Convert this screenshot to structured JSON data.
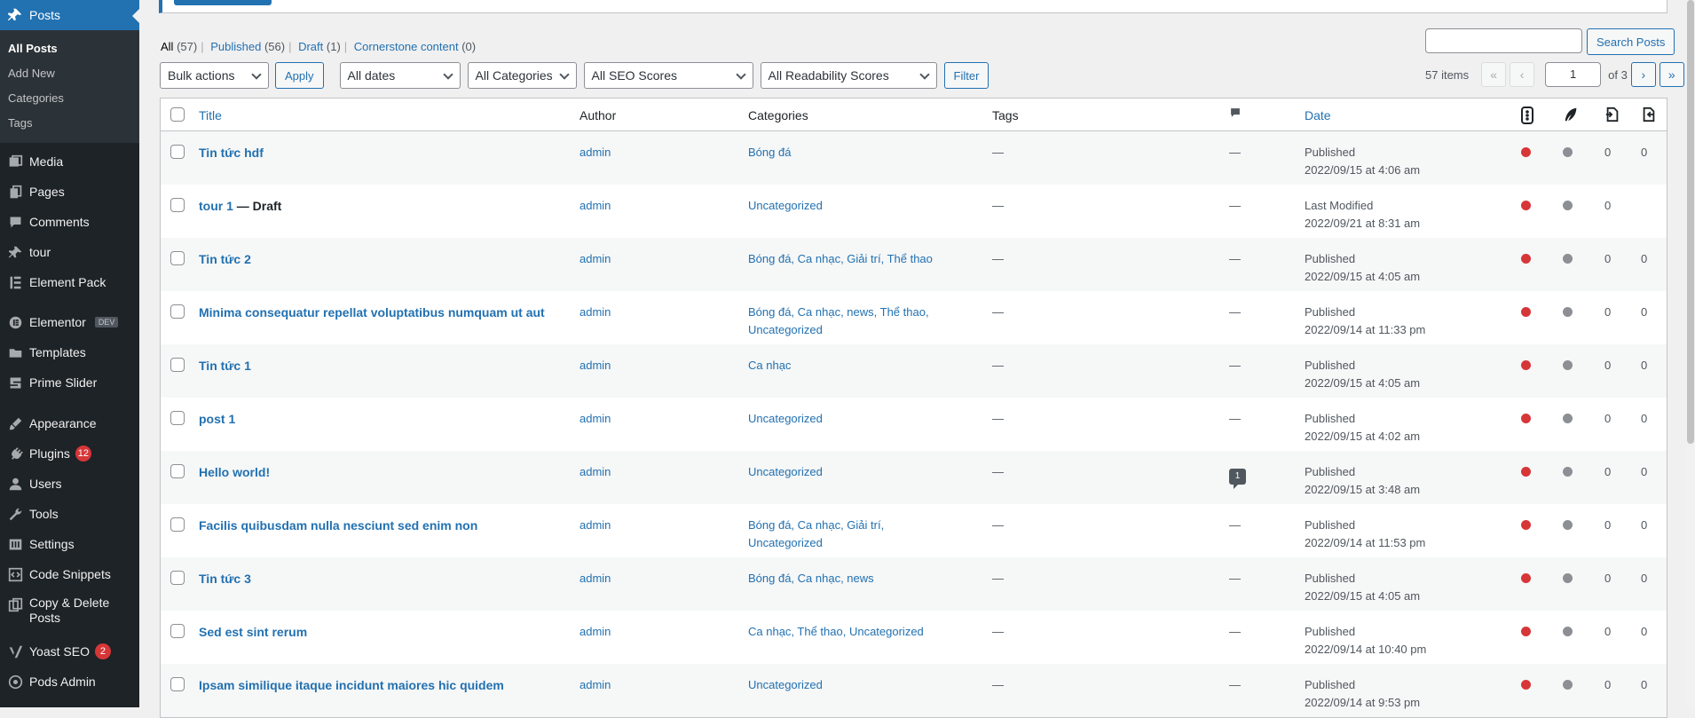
{
  "sidebar": {
    "posts": "Posts",
    "submenu": [
      "All Posts",
      "Add New",
      "Categories",
      "Tags"
    ],
    "items": [
      {
        "label": "Media",
        "icon": "media-icon"
      },
      {
        "label": "Pages",
        "icon": "pages-icon"
      },
      {
        "label": "Comments",
        "icon": "comments-icon"
      },
      {
        "label": "tour",
        "icon": "pin-icon"
      },
      {
        "label": "Element Pack",
        "icon": "element-pack-icon"
      }
    ],
    "elementor": "Elementor",
    "elementor_tag": "DEV",
    "templates": "Templates",
    "prime_slider": "Prime Slider",
    "appearance": "Appearance",
    "plugins": "Plugins",
    "plugins_badge": "12",
    "users": "Users",
    "tools": "Tools",
    "settings": "Settings",
    "code_snippets": "Code Snippets",
    "copy_delete_1": "Copy & Delete",
    "copy_delete_2": "Posts",
    "yoast": "Yoast SEO",
    "yoast_badge": "2",
    "pods": "Pods Admin"
  },
  "views": {
    "all": "All",
    "all_count": "(57)",
    "published": "Published",
    "published_count": "(56)",
    "draft": "Draft",
    "draft_count": "(1)",
    "cornerstone": "Cornerstone content",
    "cornerstone_count": "(0)"
  },
  "search": {
    "button": "Search Posts",
    "value": ""
  },
  "filters": {
    "bulk": "Bulk actions",
    "apply": "Apply",
    "dates": "All dates",
    "categories": "All Categories",
    "seo": "All SEO Scores",
    "readability": "All Readability Scores",
    "filter": "Filter"
  },
  "pagination": {
    "items": "57 items",
    "first": "«",
    "prev": "‹",
    "current": "1",
    "of": "of 3",
    "next": "›",
    "last": "»"
  },
  "table": {
    "headers": {
      "title": "Title",
      "author": "Author",
      "categories": "Categories",
      "tags": "Tags",
      "date": "Date"
    },
    "colors": {
      "seo_bad": "#d63638",
      "readability_na": "#8c8f94"
    },
    "rows": [
      {
        "title": "Tin tức hdf",
        "state": "",
        "author": "admin",
        "cats": "Bóng đá",
        "tags": "—",
        "comments": "—",
        "status": "Published",
        "date": "2022/09/15 at 4:06 am",
        "n1": "0",
        "n2": "0"
      },
      {
        "title": "tour 1",
        "state": " — Draft",
        "author": "admin",
        "cats": "Uncategorized",
        "tags": "—",
        "comments": "—",
        "status": "Last Modified",
        "date": "2022/09/21 at 8:31 am",
        "n1": "0",
        "n2": ""
      },
      {
        "title": "Tin tức 2",
        "state": "",
        "author": "admin",
        "cats": "Bóng đá, Ca nhạc, Giải trí, Thể thao",
        "tags": "—",
        "comments": "—",
        "status": "Published",
        "date": "2022/09/15 at 4:05 am",
        "n1": "0",
        "n2": "0"
      },
      {
        "title": "Minima consequatur repellat voluptatibus numquam ut aut",
        "state": "",
        "author": "admin",
        "cats": "Bóng đá, Ca nhạc, news, Thể thao, Uncategorized",
        "tags": "—",
        "comments": "—",
        "status": "Published",
        "date": "2022/09/14 at 11:33 pm",
        "n1": "0",
        "n2": "0"
      },
      {
        "title": "Tin tức 1",
        "state": "",
        "author": "admin",
        "cats": "Ca nhạc",
        "tags": "—",
        "comments": "—",
        "status": "Published",
        "date": "2022/09/15 at 4:05 am",
        "n1": "0",
        "n2": "0"
      },
      {
        "title": "post 1",
        "state": "",
        "author": "admin",
        "cats": "Uncategorized",
        "tags": "—",
        "comments": "—",
        "status": "Published",
        "date": "2022/09/15 at 4:02 am",
        "n1": "0",
        "n2": "0"
      },
      {
        "title": "Hello world!",
        "state": "",
        "author": "admin",
        "cats": "Uncategorized",
        "tags": "—",
        "comments": "1",
        "status": "Published",
        "date": "2022/09/15 at 3:48 am",
        "n1": "0",
        "n2": "0"
      },
      {
        "title": "Facilis quibusdam nulla nesciunt sed enim non",
        "state": "",
        "author": "admin",
        "cats": "Bóng đá, Ca nhạc, Giải trí, Uncategorized",
        "tags": "—",
        "comments": "—",
        "status": "Published",
        "date": "2022/09/14 at 11:53 pm",
        "n1": "0",
        "n2": "0"
      },
      {
        "title": "Tin tức 3",
        "state": "",
        "author": "admin",
        "cats": "Bóng đá, Ca nhạc, news",
        "tags": "—",
        "comments": "—",
        "status": "Published",
        "date": "2022/09/15 at 4:05 am",
        "n1": "0",
        "n2": "0"
      },
      {
        "title": "Sed est sint rerum",
        "state": "",
        "author": "admin",
        "cats": "Ca nhạc, Thể thao, Uncategorized",
        "tags": "—",
        "comments": "—",
        "status": "Published",
        "date": "2022/09/14 at 10:40 pm",
        "n1": "0",
        "n2": "0"
      },
      {
        "title": "Ipsam similique itaque incidunt maiores hic quidem",
        "state": "",
        "author": "admin",
        "cats": "Uncategorized",
        "tags": "—",
        "comments": "—",
        "status": "Published",
        "date": "2022/09/14 at 9:53 pm",
        "n1": "0",
        "n2": "0"
      }
    ]
  }
}
